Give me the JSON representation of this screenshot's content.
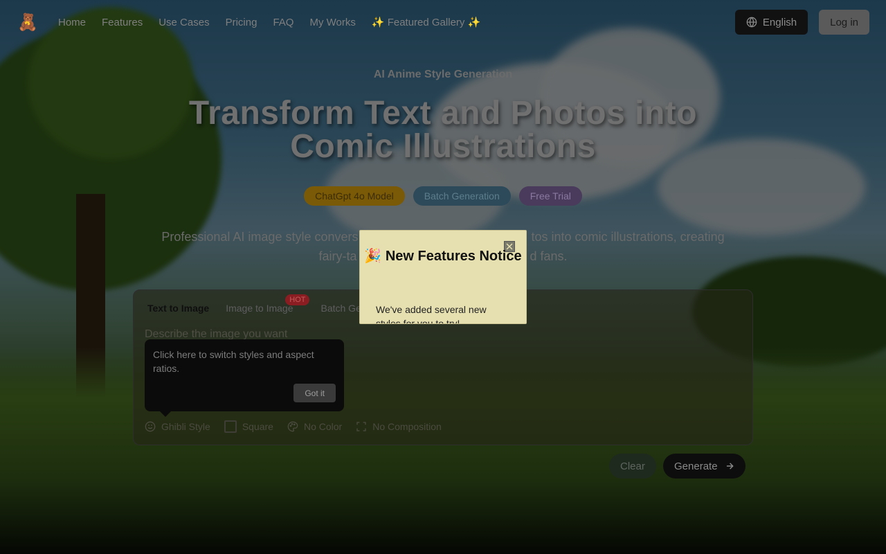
{
  "brand": {
    "logo_glyph": "🧸"
  },
  "nav": {
    "links": [
      "Home",
      "Features",
      "Use Cases",
      "Pricing",
      "FAQ",
      "My Works",
      "✨ Featured Gallery ✨"
    ],
    "language": "English",
    "login": "Log in"
  },
  "hero": {
    "eyebrow": "AI Anime Style Generation",
    "title": "Transform Text and Photos into Comic Illustrations",
    "badges": [
      "ChatGpt 4o Model",
      "Batch Generation",
      "Free Trial"
    ],
    "description_visible": "Professional AI image style convers",
    "description_visible_2": "tos into comic illustrations, creating",
    "description_line2_left": "fairy-ta",
    "description_line2_right": "d fans."
  },
  "editor": {
    "tabs": [
      "Text to Image",
      "Image to Image",
      "Batch Ge"
    ],
    "hot_badge": "HOT",
    "prompt_placeholder": "Describe the image you want",
    "options": {
      "style": "Ghibli Style",
      "ratio": "Square",
      "color": "No Color",
      "composition": "No Composition"
    },
    "clear_label": "Clear",
    "generate_label": "Generate"
  },
  "tooltip": {
    "text": "Click here to switch styles and aspect ratios.",
    "button": "Got it"
  },
  "modal": {
    "title": "🎉 New Features Notice",
    "body": "We've added several new styles for you to try!"
  },
  "colors": {
    "badge_orange": "#7a5a06",
    "badge_blue": "#2d4a5a",
    "badge_purple": "#4a3a5c",
    "modal_bg": "#e6e0b0",
    "hot_red": "#8a1d22"
  }
}
